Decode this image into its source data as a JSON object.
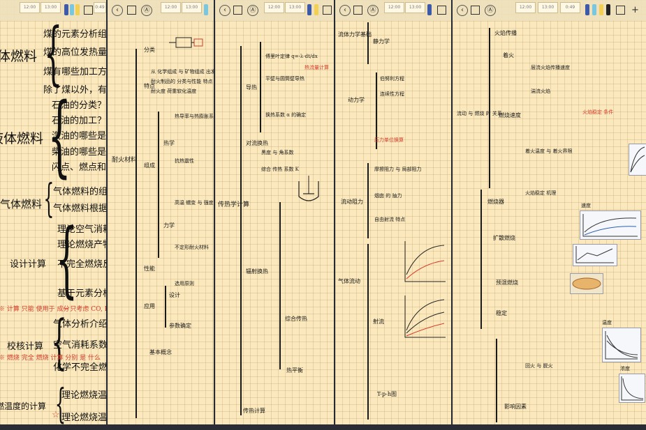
{
  "toolbar": {
    "back_glyph": "‹",
    "a_glyph": "Ⓐ",
    "thumb_labels": [
      "12:00",
      "13:00",
      "0:49"
    ],
    "add_glyph": "+"
  },
  "panel1": {
    "topics": [
      "体燃料",
      "液体燃料",
      "气体燃料",
      "设计计算",
      "校核计算",
      "燃温度的计算"
    ],
    "solid_notes": [
      "煤的元素分析组成",
      "煤的高位发热量",
      "煤有哪些加工方法",
      "除了煤以外，有哪些"
    ],
    "liquid_notes": [
      "石油的分类？",
      "石油的加工？",
      "汽油的哪些是根",
      "柴油的哪些是根",
      "闪点、燃点和着火"
    ],
    "gas_notes": [
      "气体燃料的组",
      "气体燃料根据"
    ],
    "design_notes": [
      "理论空气消耗",
      "理论燃烧产物",
      "不完全燃烧反应",
      "基于元素分析成分"
    ],
    "design_red": "※ 计算 只能 使用于 成分",
    "check_notes": [
      "气体分析介绍",
      "空气消耗系数",
      "化学不完全燃烧"
    ],
    "check_red_1": "→ 只考虑 CO, H₂, CH₄",
    "check_red_2": "※ 燃烧 完全 燃烧 计算 分别 是 什么",
    "temp_notes": [
      "理论燃烧温度",
      "理论燃烧温度"
    ],
    "temp_red_mark": "☆"
  },
  "panel2": {
    "root": "耐火材料",
    "nodes": [
      "分类",
      "特点",
      "组成",
      "性能",
      "热学",
      "力学",
      "应用",
      "设计",
      "参数确定",
      "基本概念"
    ],
    "notes": [
      "从 化学组成 与 矿物组成 出发",
      "耐火制品的 分类与性能 特点",
      "耐火度 荷重软化温度",
      "热导率与热膨胀系数",
      "抗热震性",
      "高温 蠕变 与 强度",
      "不定形耐火材料",
      "选用原则"
    ]
  },
  "panel3": {
    "root": "传热学计算",
    "nodes": [
      "导热",
      "对流换热",
      "辐射换热",
      "综合传热",
      "传热计算",
      "热平衡"
    ],
    "notes": [
      "傅里叶定律 q=-λ·dt/dx",
      "平壁与圆筒壁导热",
      "换热系数 α 的确定",
      "黑度 与 角系数",
      "综合 传热 系数 K"
    ],
    "red_note": "热流量计算"
  },
  "panel4": {
    "root": "流体力学基础",
    "nodes": [
      "静力学",
      "动力学",
      "流动阻力",
      "气体流动",
      "射流",
      "T-p-h图"
    ],
    "notes": [
      "伯努利方程",
      "连续性方程",
      "摩擦阻力 与 局部阻力",
      "烟囱 的 抽力",
      "自由射流 特点"
    ],
    "red_note": "压力单位换算"
  },
  "panel5": {
    "root": "流动 与 燃烧 的 关系",
    "nodes": [
      "火焰传播",
      "着火",
      "燃烧速度",
      "燃烧器",
      "扩散燃烧",
      "预混燃烧",
      "稳定",
      "影响因素"
    ],
    "notes": [
      "层流火焰传播速度",
      "湍流火焰",
      "着火温度 与 着火界限",
      "火焰稳定 机理",
      "回火 与 脱火"
    ],
    "figure_labels": [
      "浓度",
      "温度",
      "速度"
    ],
    "red_note": "火焰稳定 条件"
  }
}
